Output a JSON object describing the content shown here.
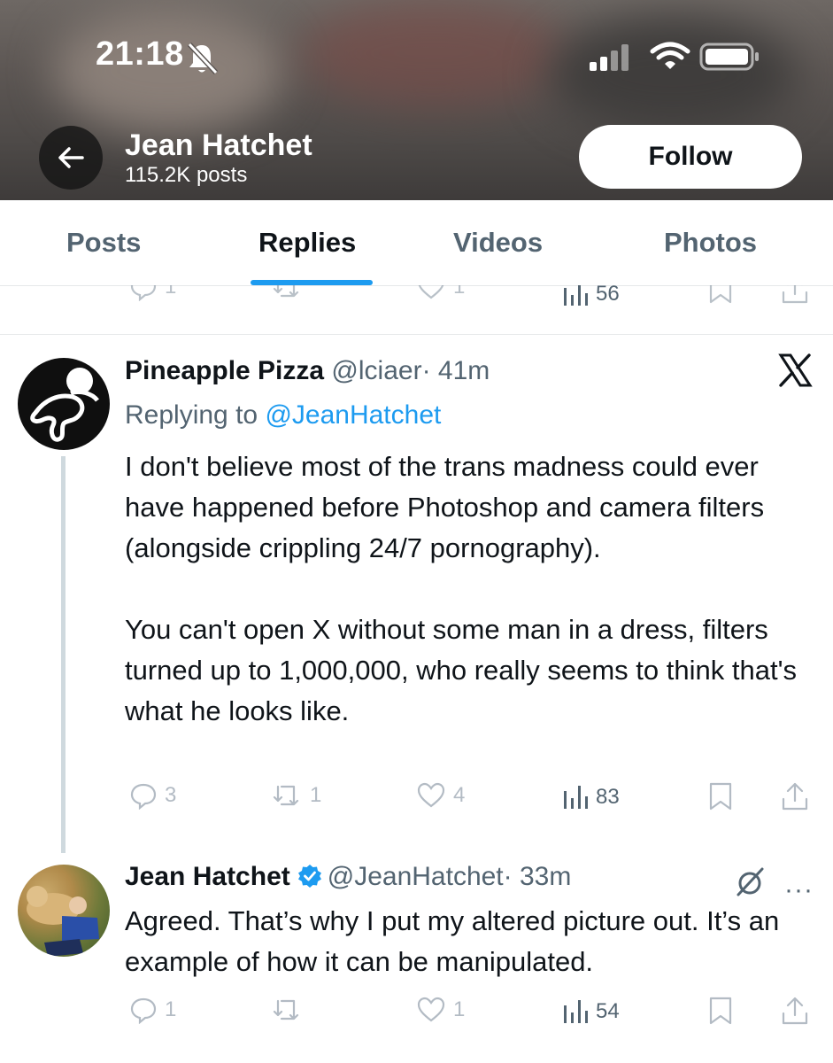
{
  "status_bar": {
    "time": "21:18"
  },
  "header": {
    "name": "Jean Hatchet",
    "posts": "115.2K posts",
    "follow_label": "Follow"
  },
  "tabs": [
    {
      "label": "Posts"
    },
    {
      "label": "Replies"
    },
    {
      "label": "Videos"
    },
    {
      "label": "Photos"
    }
  ],
  "prev_actions": {
    "replies": "1",
    "likes": "1",
    "views": "56"
  },
  "tweet1": {
    "name": "Pineapple Pizza",
    "handle": "@lciaer",
    "time": "· 41m",
    "replying_prefix": "Replying to ",
    "replying_handle": "@JeanHatchet",
    "body": "I don't believe most of the trans madness could ever have happened before Photoshop and camera filters (alongside crippling 24/7 pornography).\n\nYou can't open X without some man in a dress, filters turned up to 1,000,000, who really seems to think that's what he looks like.",
    "actions": {
      "replies": "3",
      "reposts": "1",
      "likes": "4",
      "views": "83"
    }
  },
  "tweet2": {
    "name": "Jean Hatchet",
    "handle": "@JeanHatchet",
    "time": "· 33m",
    "more": "···",
    "body": "Agreed. That’s why I put my altered picture out. It’s an example of how it can be manipulated.",
    "actions": {
      "replies": "1",
      "reposts": "",
      "likes": "1",
      "views": "54"
    }
  },
  "colors": {
    "accent": "#1d9bf0",
    "text": "#0f1419",
    "muted": "#536471"
  },
  "icons": [
    "back-arrow-icon",
    "bell-muted-icon",
    "signal-icon",
    "wifi-icon",
    "battery-icon",
    "x-logo-icon",
    "verified-icon",
    "grok-icon",
    "reply-icon",
    "repost-icon",
    "like-icon",
    "views-icon",
    "bookmark-icon",
    "share-icon"
  ]
}
